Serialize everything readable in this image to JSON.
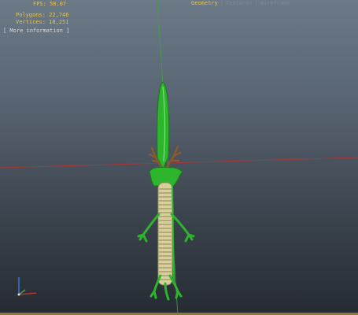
{
  "hud": {
    "fps": "FPS: 58.07",
    "polygons": "Polygons: 22,746",
    "vertices": "Vertices: 18,251",
    "more_information": "[ More information ]"
  },
  "render_tabs": {
    "geometry": "Geometry",
    "textures": "Textures",
    "wireframe": "Wireframe",
    "separator": "|"
  },
  "colors": {
    "hud_text": "#e6c24a",
    "model_green": "#2db52d",
    "model_scale": "#d9cf9a",
    "horn_brown": "#8a5a2b",
    "axis_red": "#b8322e",
    "axis_green": "#3ca43c"
  },
  "scene": {
    "model": "green serpent dragon standing upright, top-down view",
    "gizmo_axes": [
      "x-axis",
      "y-axis",
      "z-axis"
    ]
  }
}
